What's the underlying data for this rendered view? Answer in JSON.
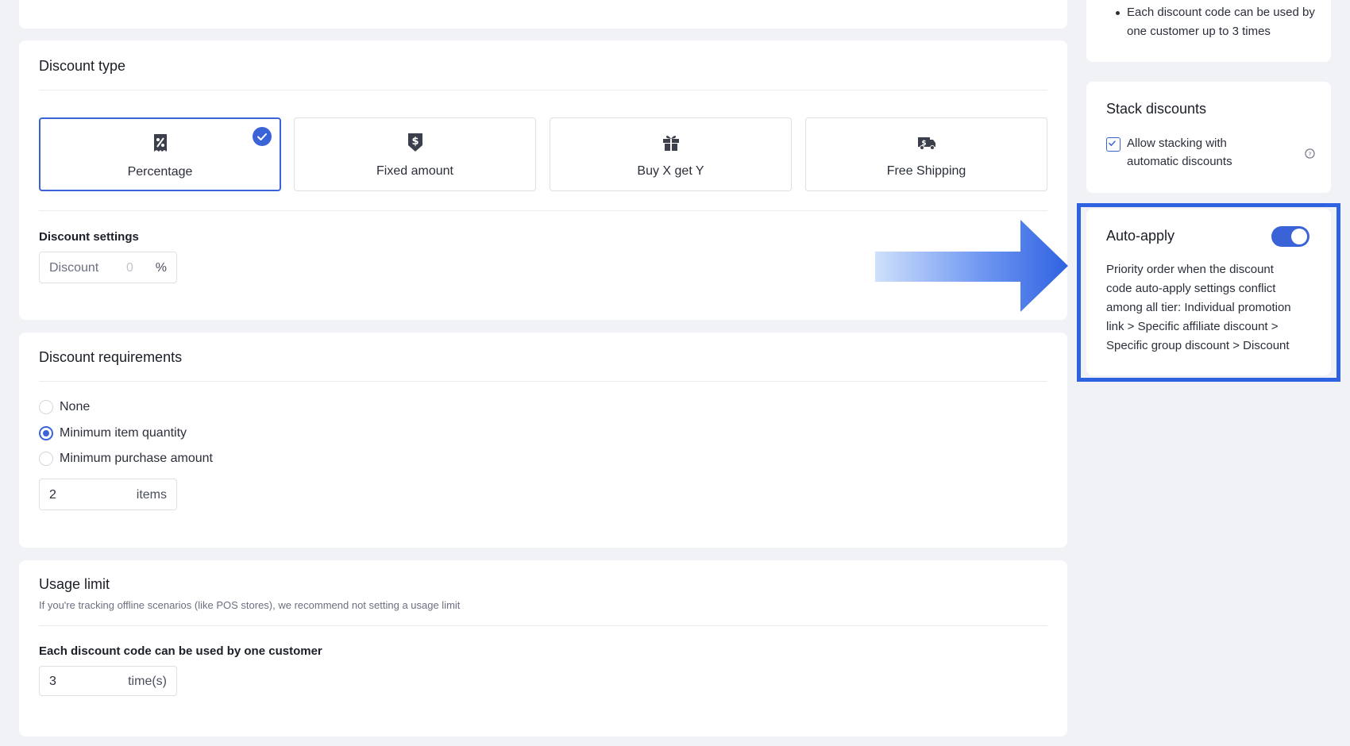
{
  "top_note": {
    "bullet": "Each discount code can be used by one customer up to 3 times"
  },
  "discount_type": {
    "title": "Discount type",
    "options": [
      {
        "label": "Percentage",
        "icon": "percent-receipt-icon",
        "selected": true
      },
      {
        "label": "Fixed amount",
        "icon": "dollar-tag-icon",
        "selected": false
      },
      {
        "label": "Buy X get Y",
        "icon": "gift-icon",
        "selected": false
      },
      {
        "label": "Free Shipping",
        "icon": "shipping-truck-icon",
        "selected": false
      }
    ],
    "settings_label": "Discount settings",
    "discount_input": {
      "label": "Discount",
      "placeholder": "0",
      "suffix": "%"
    }
  },
  "requirements": {
    "title": "Discount requirements",
    "options": [
      {
        "label": "None",
        "selected": false
      },
      {
        "label": "Minimum item quantity",
        "selected": true
      },
      {
        "label": "Minimum purchase amount",
        "selected": false
      }
    ],
    "quantity_input": {
      "value": "2",
      "suffix": "items"
    }
  },
  "usage_limit": {
    "title": "Usage limit",
    "hint": "If you're tracking offline scenarios (like POS stores), we recommend not setting a usage limit",
    "per_customer_label": "Each discount code can be used by one customer",
    "times_input": {
      "value": "3",
      "suffix": "time(s)"
    }
  },
  "stack_discounts": {
    "title": "Stack discounts",
    "checkbox_label_line1": "Allow stacking with",
    "checkbox_label_line2": "automatic discounts",
    "checked": true
  },
  "auto_apply": {
    "title": "Auto-apply",
    "enabled": true,
    "description_lines": [
      "Priority order when the discount",
      "code auto-apply settings conflict",
      "among all tier: Individual promotion",
      "link > Specific affiliate discount >",
      "Specific group discount > Discount"
    ]
  },
  "colors": {
    "accent": "#3a63d8",
    "highlight": "#2f62e0",
    "background": "#f1f2f5"
  }
}
